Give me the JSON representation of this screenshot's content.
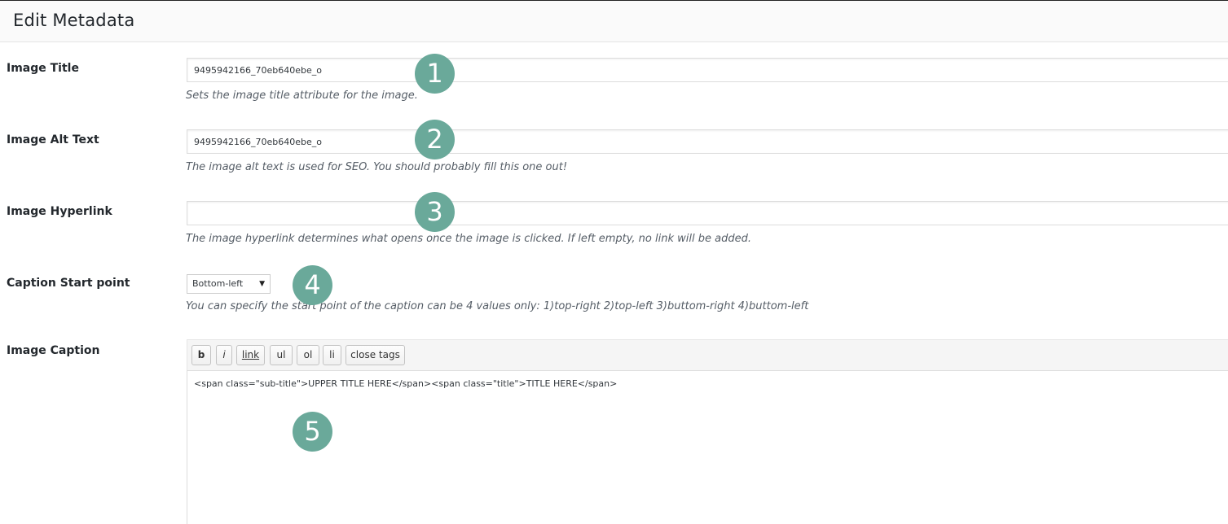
{
  "header": {
    "title": "Edit Metadata"
  },
  "fields": {
    "image_title": {
      "label": "Image Title",
      "value": "9495942166_70eb640ebe_o",
      "description": "Sets the image title attribute for the image."
    },
    "image_alt": {
      "label": "Image Alt Text",
      "value": "9495942166_70eb640ebe_o",
      "description": "The image alt text is used for SEO. You should probably fill this one out!"
    },
    "image_hyperlink": {
      "label": "Image Hyperlink",
      "value": "",
      "description": "The image hyperlink determines what opens once the image is clicked. If left empty, no link will be added."
    },
    "caption_start": {
      "label": "Caption Start point",
      "selected": "Bottom-left",
      "description": "You can specify the start point of the caption can be 4 values only: 1)top-right 2)top-left 3)buttom-right 4)buttom-left"
    },
    "image_caption": {
      "label": "Image Caption",
      "toolbar": [
        "b",
        "i",
        "link",
        "ul",
        "ol",
        "li",
        "close tags"
      ],
      "content": "<span class=\"sub-title\">UPPER TITLE HERE</span><span class=\"title\">TITLE HERE</span>"
    }
  },
  "callouts": [
    "1",
    "2",
    "3",
    "4",
    "5"
  ],
  "colors": {
    "callout_bg": "#6aa99a",
    "header_bg": "#fafafa"
  }
}
